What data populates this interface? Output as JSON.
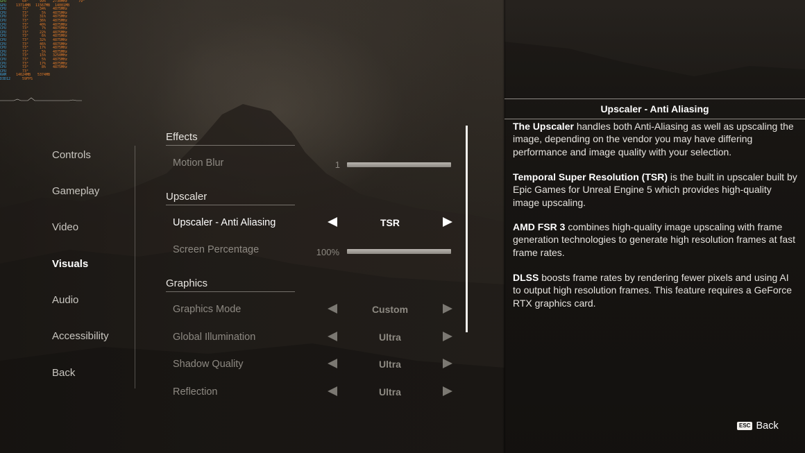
{
  "hud": {
    "rows": [
      {
        "label": "GPU",
        "v1": "64",
        "u1": "°",
        "v2": "99",
        "u2": "%",
        "v3": "2730",
        "u3": "MHz",
        "v4": "79",
        "u4": "°"
      },
      {
        "label": "GPU",
        "v1": "13714",
        "u1": "MB",
        "v2": "11567",
        "u2": "MB",
        "v3": "14001",
        "u3": "MB",
        "v4": "",
        "u4": ""
      },
      {
        "label": "CPU",
        "v1": "73",
        "u1": "°",
        "v2": "34",
        "u2": "%",
        "v3": "4875",
        "u3": "MHz",
        "v4": "",
        "u4": ""
      },
      {
        "label": "CPU",
        "v1": "73",
        "u1": "°",
        "v2": "5",
        "u2": "%",
        "v3": "4875",
        "u3": "MHz",
        "v4": "",
        "u4": ""
      },
      {
        "label": "CPU",
        "v1": "73",
        "u1": "°",
        "v2": "31",
        "u2": "%",
        "v3": "4875",
        "u3": "MHz",
        "v4": "",
        "u4": ""
      },
      {
        "label": "CPU",
        "v1": "73",
        "u1": "°",
        "v2": "36",
        "u2": "%",
        "v3": "4875",
        "u3": "MHz",
        "v4": "",
        "u4": ""
      },
      {
        "label": "CPU",
        "v1": "73",
        "u1": "°",
        "v2": "40",
        "u2": "%",
        "v3": "4875",
        "u3": "MHz",
        "v4": "",
        "u4": ""
      },
      {
        "label": "CPU",
        "v1": "73",
        "u1": "°",
        "v2": "7",
        "u2": "%",
        "v3": "4875",
        "u3": "MHz",
        "v4": "",
        "u4": ""
      },
      {
        "label": "CPU",
        "v1": "73",
        "u1": "°",
        "v2": "22",
        "u2": "%",
        "v3": "4875",
        "u3": "MHz",
        "v4": "",
        "u4": ""
      },
      {
        "label": "CPU",
        "v1": "73",
        "u1": "°",
        "v2": "6",
        "u2": "%",
        "v3": "4875",
        "u3": "MHz",
        "v4": "",
        "u4": ""
      },
      {
        "label": "CPU",
        "v1": "73",
        "u1": "°",
        "v2": "32",
        "u2": "%",
        "v3": "4875",
        "u3": "MHz",
        "v4": "",
        "u4": ""
      },
      {
        "label": "CPU",
        "v1": "73",
        "u1": "°",
        "v2": "46",
        "u2": "%",
        "v3": "4875",
        "u3": "MHz",
        "v4": "",
        "u4": ""
      },
      {
        "label": "CPU",
        "v1": "73",
        "u1": "°",
        "v2": "17",
        "u2": "%",
        "v3": "4875",
        "u3": "MHz",
        "v4": "",
        "u4": ""
      },
      {
        "label": "CPU",
        "v1": "73",
        "u1": "°",
        "v2": "5",
        "u2": "%",
        "v3": "4875",
        "u3": "MHz",
        "v4": "",
        "u4": ""
      },
      {
        "label": "CPU",
        "v1": "73",
        "u1": "°",
        "v2": "15",
        "u2": "%",
        "v3": "3250",
        "u3": "MHz",
        "v4": "",
        "u4": ""
      },
      {
        "label": "CPU",
        "v1": "73",
        "u1": "°",
        "v2": "5",
        "u2": "%",
        "v3": "4875",
        "u3": "MHz",
        "v4": "",
        "u4": ""
      },
      {
        "label": "CPU",
        "v1": "73",
        "u1": "°",
        "v2": "17",
        "u2": "%",
        "v3": "4875",
        "u3": "MHz",
        "v4": "",
        "u4": ""
      },
      {
        "label": "CPU",
        "v1": "73",
        "u1": "°",
        "v2": "8",
        "u2": "%",
        "v3": "4875",
        "u3": "MHz",
        "v4": "",
        "u4": ""
      },
      {
        "label": "CPU",
        "v1": "73",
        "u1": "°",
        "v2": "",
        "u2": "",
        "v3": "",
        "u3": "",
        "v4": "",
        "u4": ""
      },
      {
        "label": "RAM",
        "v1": "14624",
        "u1": "MB",
        "v2": "5374",
        "u2": "MB",
        "v3": "",
        "u3": "",
        "v4": "",
        "u4": ""
      },
      {
        "label": "D3D12",
        "v1": "59",
        "u1": "FPS",
        "v2": "",
        "u2": "",
        "v3": "",
        "u3": "",
        "v4": "",
        "u4": ""
      }
    ]
  },
  "nav": {
    "items": [
      {
        "label": "Controls",
        "active": false
      },
      {
        "label": "Gameplay",
        "active": false
      },
      {
        "label": "Video",
        "active": false
      },
      {
        "label": "Visuals",
        "active": true
      },
      {
        "label": "Audio",
        "active": false
      },
      {
        "label": "Accessibility",
        "active": false
      },
      {
        "label": "Back",
        "active": false
      }
    ]
  },
  "sections": {
    "effects": "Effects",
    "upscaler": "Upscaler",
    "graphics": "Graphics"
  },
  "settings": {
    "motion_blur": {
      "label": "Motion Blur",
      "value": "1",
      "level": 1.0
    },
    "upscaler_aa": {
      "label": "Upscaler - Anti Aliasing",
      "value": "TSR"
    },
    "screen_percentage": {
      "label": "Screen Percentage",
      "value": "100%",
      "level": 1.0
    },
    "graphics_mode": {
      "label": "Graphics Mode",
      "value": "Custom"
    },
    "global_illumination": {
      "label": "Global Illumination",
      "value": "Ultra"
    },
    "shadow_quality": {
      "label": "Shadow Quality",
      "value": "Ultra"
    },
    "reflection": {
      "label": "Reflection",
      "value": "Ultra"
    }
  },
  "panel": {
    "title": "Upscaler - Anti Aliasing",
    "p1_bold": "The Upscaler",
    "p1_text": " handles both Anti-Aliasing as well as upscaling the image, depending on the vendor you may have differing performance and image quality with your selection.",
    "p2_bold": "Temporal Super Resolution (TSR)",
    "p2_text": "  is the built in upscaler built by Epic Games for Unreal Engine 5 which provides high-quality image upscaling.",
    "p3_bold": "AMD FSR 3",
    "p3_text": " combines high-quality image upscaling with frame generation technologies to generate high resolution frames at fast frame rates.",
    "p4_bold": "DLSS",
    "p4_text": " boosts frame rates by rendering fewer pixels and using AI to output high resolution frames. This feature requires a GeForce RTX graphics card."
  },
  "footer": {
    "key": "ESC",
    "back_label": "Back"
  },
  "colors": {
    "text_active": "#ffffff",
    "text_inactive": "#8d8982",
    "hud_label": "#3f9fd8",
    "hud_value": "#e07a2a"
  }
}
